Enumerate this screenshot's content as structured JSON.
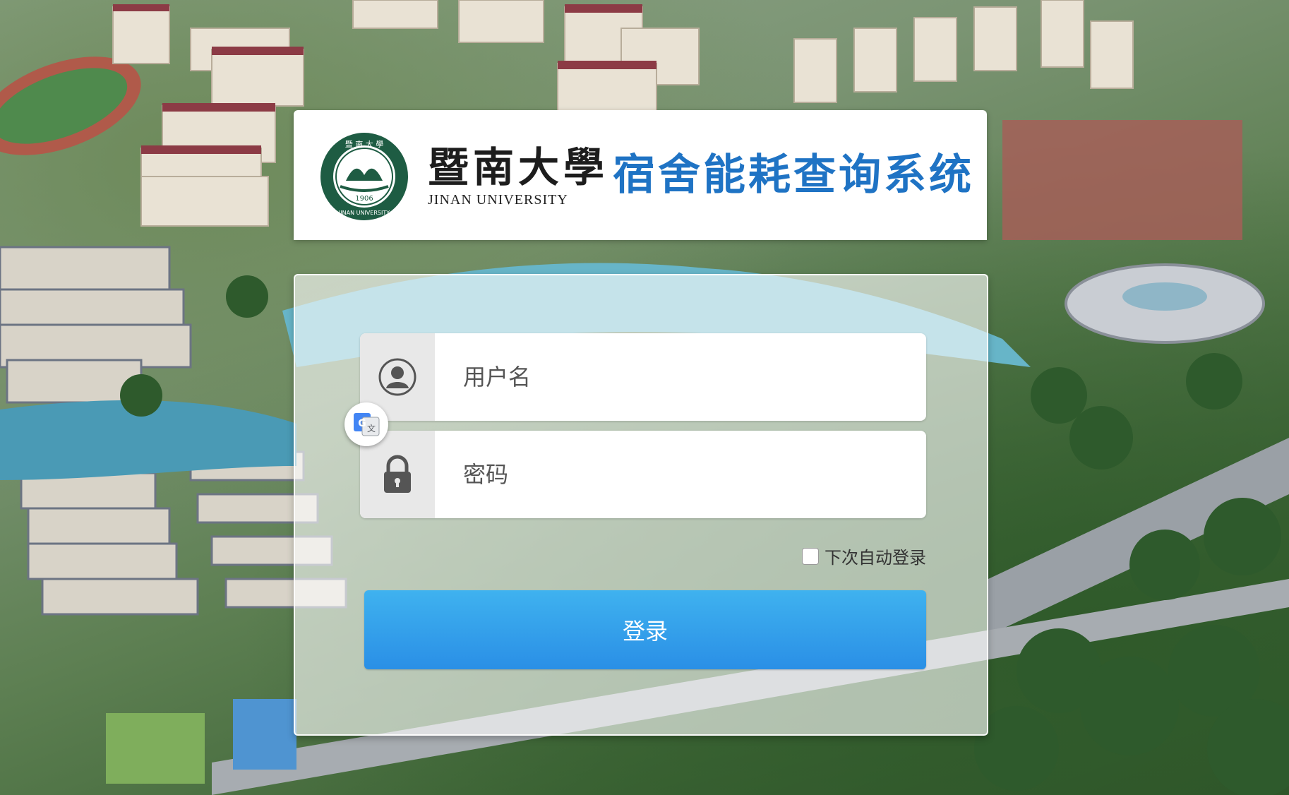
{
  "header": {
    "university_name_cn": "暨南大學",
    "university_name_en": "JINAN UNIVERSITY",
    "seal_text": "JINAN UNIVERSITY",
    "seal_year": "1906",
    "system_title": "宿舍能耗查询系统"
  },
  "form": {
    "username": {
      "placeholder": "用户名",
      "value": "",
      "icon": "user-icon"
    },
    "password": {
      "placeholder": "密码",
      "value": "",
      "icon": "lock-icon"
    },
    "remember_label": "下次自动登录",
    "remember_checked": false,
    "login_label": "登录"
  },
  "overlay": {
    "translate_icon": "google-translate-icon"
  },
  "colors": {
    "title_blue": "#1f73c4",
    "button_blue": "#2a8fe6",
    "seal_green": "#1e5c43"
  }
}
